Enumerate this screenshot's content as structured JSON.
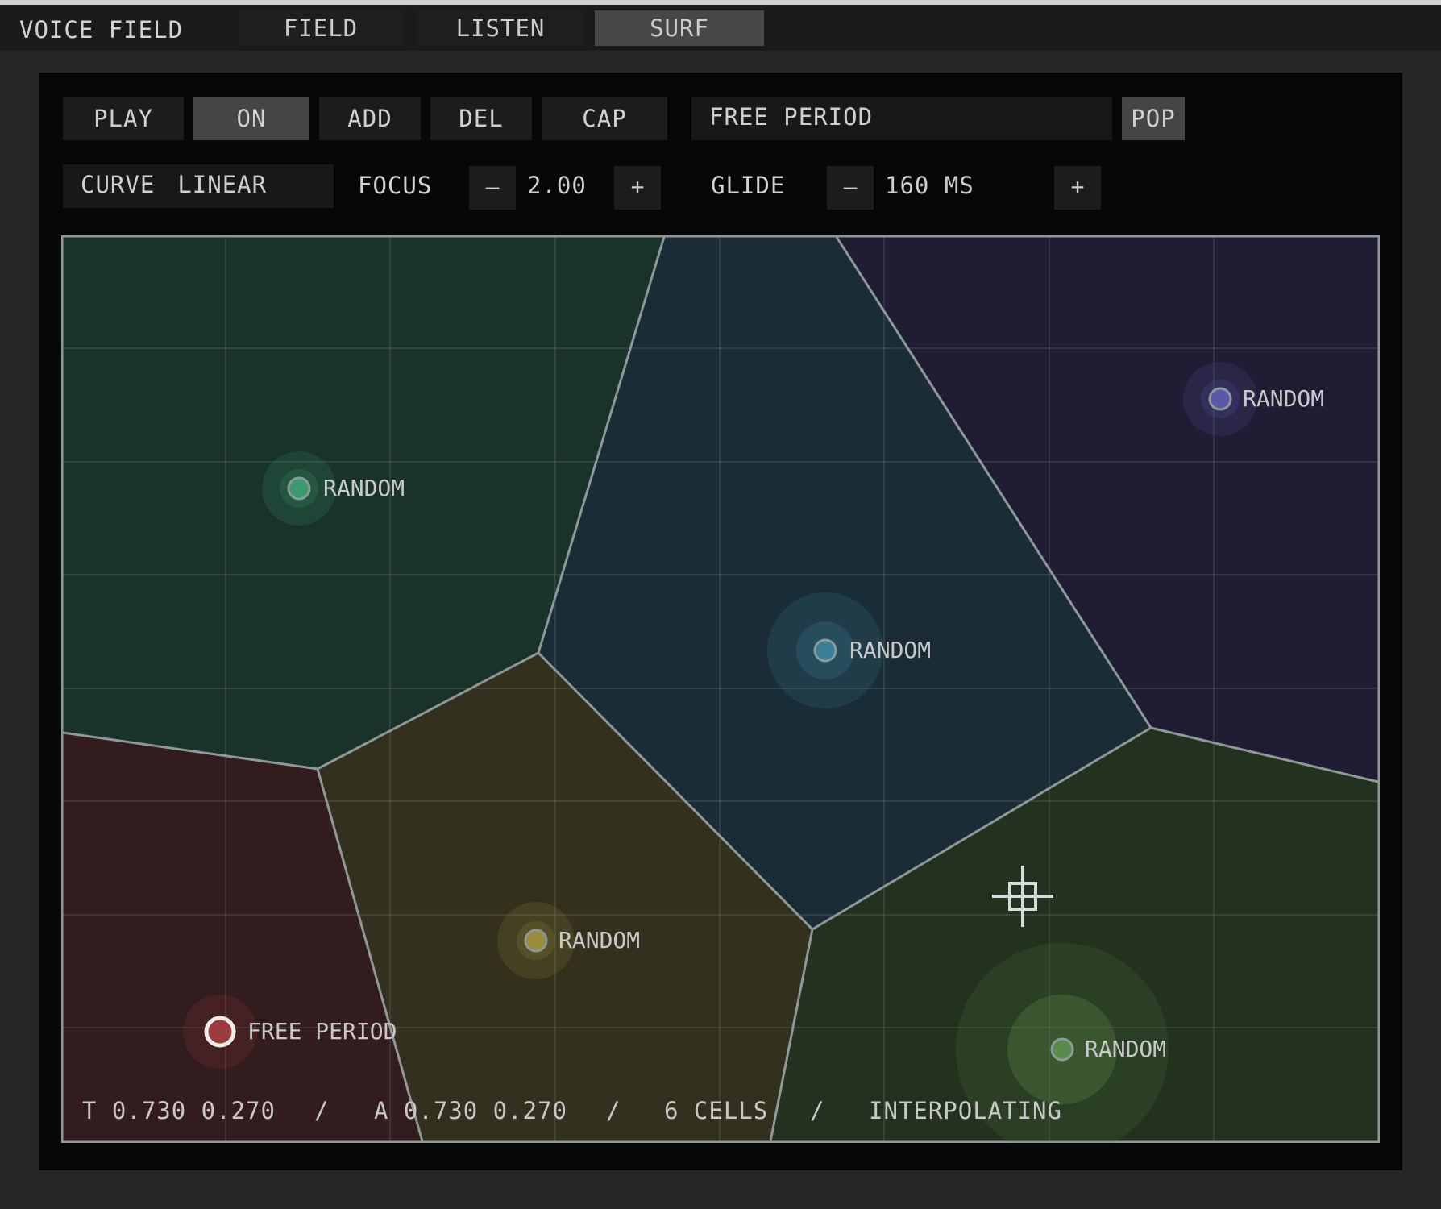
{
  "app": {
    "title": "VOICE FIELD"
  },
  "tabs": [
    {
      "label": "FIELD",
      "active": false
    },
    {
      "label": "LISTEN",
      "active": false
    },
    {
      "label": "SURF",
      "active": true
    }
  ],
  "toolbar": {
    "play_label": "PLAY",
    "on_label": "ON",
    "add_label": "ADD",
    "del_label": "DEL",
    "cap_label": "CAP",
    "name_value": "FREE PERIOD",
    "pop_label": "POP"
  },
  "controls": {
    "curve_label": "CURVE",
    "curve_value": "LINEAR",
    "focus_label": "FOCUS",
    "focus_value": "2.00",
    "glide_label": "GLIDE",
    "glide_value": "160 MS",
    "minus": "–",
    "plus": "+"
  },
  "cells": [
    {
      "name": "RANDOM",
      "color": "#3a9a6e",
      "fill": "#19322a"
    },
    {
      "name": "RANDOM",
      "color": "#3a7f98",
      "fill": "#1a2c36"
    },
    {
      "name": "RANDOM",
      "color": "#5a58a8",
      "fill": "#1f1c34"
    },
    {
      "name": "RANDOM",
      "color": "#9a8a3a",
      "fill": "#33301e"
    },
    {
      "name": "RANDOM",
      "color": "#5a8a4a",
      "fill": "#23321e"
    },
    {
      "name": "FREE PERIOD",
      "color": "#9b3b3b",
      "fill": "#321c1e",
      "selected": true
    }
  ],
  "status": {
    "target": "T 0.730 0.270",
    "actual": "A 0.730 0.270",
    "cells": "6 CELLS",
    "state": "INTERPOLATING",
    "sep": "/"
  },
  "icons": {
    "crosshair": "crosshair-icon"
  }
}
